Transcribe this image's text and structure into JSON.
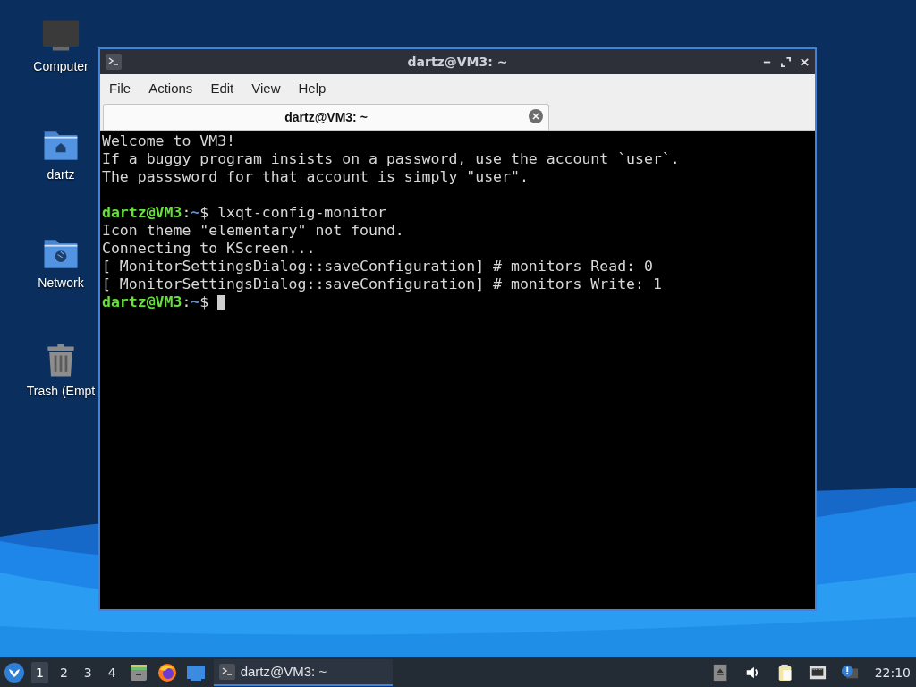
{
  "desktop_icons": [
    {
      "label": "Computer",
      "kind": "computer"
    },
    {
      "label": "dartz",
      "kind": "home"
    },
    {
      "label": "Network",
      "kind": "network"
    },
    {
      "label": "Trash (Empt",
      "kind": "trash"
    }
  ],
  "window": {
    "title": "dartz@VM3: ~",
    "menu": [
      "File",
      "Actions",
      "Edit",
      "View",
      "Help"
    ],
    "tabs": [
      {
        "label": "dartz@VM3: ~",
        "selected": true
      }
    ],
    "terminal": {
      "lines": [
        {
          "kind": "output",
          "text": "Welcome to VM3!"
        },
        {
          "kind": "output",
          "text": "If a buggy program insists on a password, use the account `user`."
        },
        {
          "kind": "output",
          "text": "The passsword for that account is simply \"user\"."
        },
        {
          "kind": "blank"
        },
        {
          "kind": "prompt",
          "user": "dartz@VM3",
          "sep": ":",
          "path": "~",
          "command": "$ lxqt-config-monitor",
          "cursor": false
        },
        {
          "kind": "output",
          "text": "Icon theme \"elementary\" not found."
        },
        {
          "kind": "output",
          "text": "Connecting to KScreen..."
        },
        {
          "kind": "output",
          "text": "[ MonitorSettingsDialog::saveConfiguration] # monitors Read: 0"
        },
        {
          "kind": "output",
          "text": "[ MonitorSettingsDialog::saveConfiguration] # monitors Write: 1"
        },
        {
          "kind": "prompt",
          "user": "dartz@VM3",
          "sep": ":",
          "path": "~",
          "command": "$",
          "cursor": true
        }
      ]
    }
  },
  "taskbar": {
    "desktops": [
      {
        "label": "1",
        "selected": true
      },
      {
        "label": "2",
        "selected": false
      },
      {
        "label": "3",
        "selected": false
      },
      {
        "label": "4",
        "selected": false
      }
    ],
    "launchers": [
      {
        "kind": "files"
      },
      {
        "kind": "browser"
      },
      {
        "kind": "desktop"
      }
    ],
    "tasks": [
      {
        "label": "dartz@VM3: ~",
        "selected": true
      }
    ],
    "tray": [
      {
        "kind": "eject"
      },
      {
        "kind": "volume"
      },
      {
        "kind": "clipboard"
      },
      {
        "kind": "network"
      },
      {
        "kind": "update"
      }
    ],
    "clock": "22:10"
  }
}
